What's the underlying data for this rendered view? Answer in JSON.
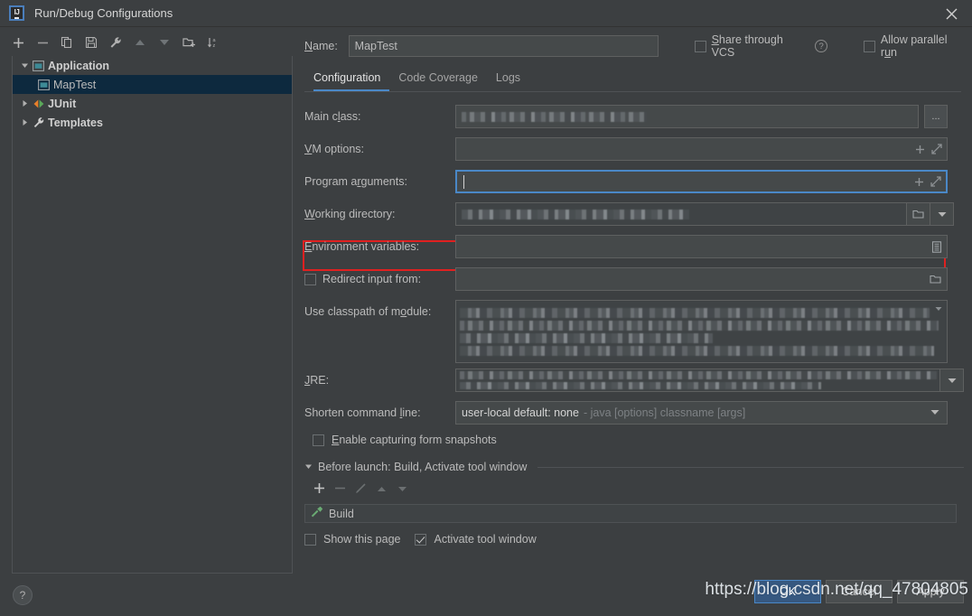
{
  "window": {
    "title": "Run/Debug Configurations",
    "logo_text": "IJ",
    "close_icon": "close-icon"
  },
  "left_toolbar": {
    "buttons": [
      {
        "name": "add-configuration-button",
        "icon": "plus-icon",
        "label": "+"
      },
      {
        "name": "remove-configuration-button",
        "icon": "minus-icon",
        "label": "−"
      },
      {
        "name": "copy-configuration-button",
        "icon": "copy-icon",
        "label": "copy"
      },
      {
        "name": "save-configuration-button",
        "icon": "save-icon",
        "label": "save"
      },
      {
        "name": "edit-templates-button",
        "icon": "wrench-icon",
        "label": "wrench"
      },
      {
        "name": "move-up-button",
        "icon": "chevron-up-icon",
        "label": "up"
      },
      {
        "name": "move-down-button",
        "icon": "chevron-down-icon",
        "label": "down"
      },
      {
        "name": "new-folder-button",
        "icon": "new-folder-icon",
        "label": "folder"
      },
      {
        "name": "sort-configurations-button",
        "icon": "sort-az-icon",
        "label": "sort"
      }
    ]
  },
  "tree": {
    "items": [
      {
        "label": "Application",
        "icon": "application-icon",
        "expanded": true,
        "bold": true,
        "selected": false,
        "indent": 0
      },
      {
        "label": "MapTest",
        "icon": "application-icon",
        "expanded": false,
        "bold": false,
        "selected": true,
        "indent": 1
      },
      {
        "label": "JUnit",
        "icon": "junit-icon",
        "expanded": false,
        "bold": true,
        "selected": false,
        "indent": 0
      },
      {
        "label": "Templates",
        "icon": "wrench-icon",
        "expanded": false,
        "bold": true,
        "selected": false,
        "indent": 0
      }
    ]
  },
  "header": {
    "name_label": "Name:",
    "name_value": "MapTest",
    "share_vcs_label": "Share through VCS",
    "share_vcs_checked": false,
    "share_vcs_help": "?",
    "allow_parallel_label": "Allow parallel run",
    "allow_parallel_checked": false
  },
  "tabs": [
    {
      "label": "Configuration",
      "active": true
    },
    {
      "label": "Code Coverage",
      "active": false
    },
    {
      "label": "Logs",
      "active": false
    }
  ],
  "form": {
    "main_class": {
      "label": "Main class:",
      "value": "",
      "redacted": true,
      "browse_button": "..."
    },
    "vm_options": {
      "label": "VM options:",
      "value": "",
      "placeholder": "",
      "icons": [
        "plus-icon",
        "expand-icon"
      ]
    },
    "program_arguments": {
      "label": "Program arguments:",
      "value": "",
      "focused": true,
      "highlighted": true,
      "highlight_color": "#e02020",
      "focus_color": "#4a88c7",
      "icons": [
        "plus-icon",
        "expand-icon"
      ]
    },
    "working_directory": {
      "label": "Working directory:",
      "value": "",
      "redacted": true,
      "icons": [
        "folder-icon",
        "chevron-down-icon"
      ]
    },
    "environment_variables": {
      "label": "Environment variables:",
      "value": "",
      "icons": [
        "list-edit-icon"
      ]
    },
    "redirect_input": {
      "label": "Redirect input from:",
      "checked": false,
      "value": "",
      "icons": [
        "folder-icon"
      ]
    },
    "use_classpath_of_module": {
      "label": "Use classpath of module:",
      "value": "",
      "redacted": true
    },
    "jre": {
      "label": "JRE:",
      "value": "",
      "redacted": true
    },
    "shorten_command_line": {
      "label": "Shorten command line:",
      "value_strong": "user-local default: none",
      "value_dim": "- java [options] classname [args]"
    },
    "enable_capturing": {
      "label": "Enable capturing form snapshots",
      "checked": false
    }
  },
  "before_launch": {
    "title": "Before launch: Build, Activate tool window",
    "expanded": true,
    "toolbar": [
      {
        "name": "add-task-button",
        "icon": "plus-icon",
        "enabled": true
      },
      {
        "name": "remove-task-button",
        "icon": "minus-icon",
        "enabled": false
      },
      {
        "name": "edit-task-button",
        "icon": "pencil-icon",
        "enabled": false
      },
      {
        "name": "move-task-up-button",
        "icon": "chevron-up-icon",
        "enabled": false
      },
      {
        "name": "move-task-down-button",
        "icon": "chevron-down-icon",
        "enabled": false
      }
    ],
    "tasks": [
      {
        "label": "Build",
        "icon": "hammer-icon",
        "icon_color": "#6aab73"
      }
    ],
    "show_this_page": {
      "label": "Show this page",
      "checked": false
    },
    "activate_tool_window": {
      "label": "Activate tool window",
      "checked": true
    }
  },
  "footer": {
    "help_label": "?",
    "buttons": [
      {
        "label": "OK",
        "primary": true
      },
      {
        "label": "Cancel",
        "primary": false
      },
      {
        "label": "Apply",
        "primary": false
      }
    ],
    "watermark": "https://blog.csdn.net/qq_47804805"
  },
  "colors": {
    "background": "#3c3f41",
    "field_background": "#45494a",
    "border": "#5e6060",
    "accent_blue": "#4a88c7",
    "selection_blue": "#0d293e",
    "highlight_red": "#e02020",
    "text": "#bbbbbb",
    "build_green": "#6aab73",
    "junit_orange": "#e8802a"
  }
}
